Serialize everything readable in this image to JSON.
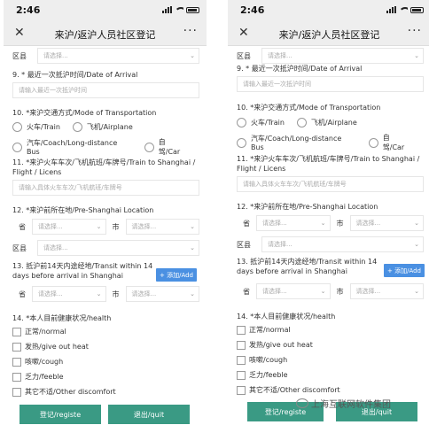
{
  "status": {
    "time": "2:46"
  },
  "header": {
    "title": "来沪/返沪人员社区登记",
    "close_icon": "close-icon",
    "more_icon": "more-icon"
  },
  "form": {
    "district_label": "区县",
    "select_placeholder": "请选择...",
    "q9_label": "9. * 最近一次抵沪时间/Date of Arrival",
    "q9_placeholder": "请输入最近一次抵沪时间",
    "q10_label": "10. *来沪交通方式/Mode of Transportation",
    "q10_options": [
      "火车/Train",
      "飞机/Airplane",
      "汽车/Coach/Long-distance Bus",
      "自驾/Car"
    ],
    "q11_label": "11. *来沪火车车次/飞机航班/车牌号/Train to Shanghai / Flight / Licens",
    "q11_placeholder": "请输入具体火车车次/飞机航班/车牌号",
    "q12_label": "12. *来沪前所在地/Pre-Shanghai Location",
    "province_label": "省",
    "city_label": "市",
    "q13_label": "13. 抵沪前14天内途经地/Transit within 14 days before arrival in Shanghai",
    "add_label": "+ 添加/Add",
    "q14_label": "14. *本人目前健康状况/health",
    "health_options": [
      "正常/normal",
      "发热/give out heat",
      "咳嗽/cough",
      "乏力/feeble",
      "其它不适/Other discomfort"
    ],
    "register_label": "登记/registe",
    "quit_label": "退出/quit"
  },
  "watermark": {
    "text": "上海互联网软件集团"
  },
  "colors": {
    "button": "#3a9a84",
    "add_button": "#4a90e2"
  }
}
